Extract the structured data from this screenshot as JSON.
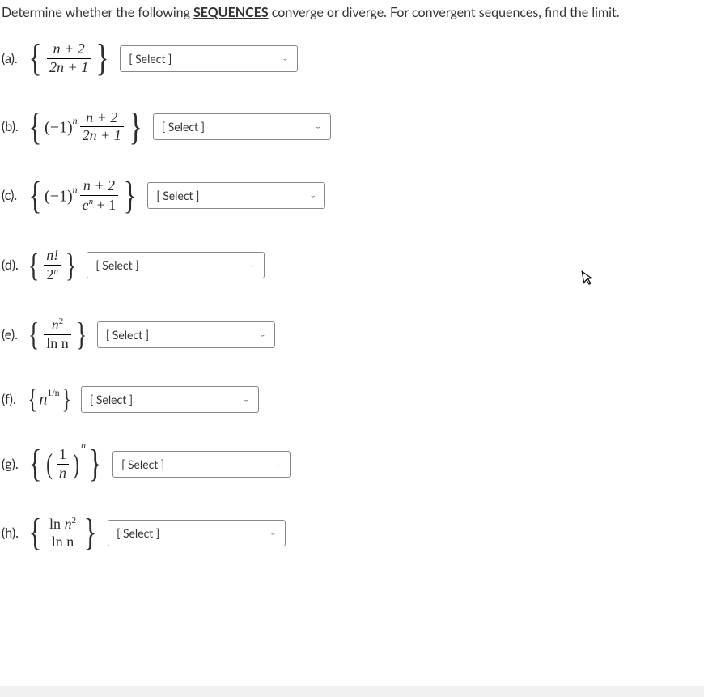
{
  "instructions_pre": "Determine whether the following ",
  "instructions_bold": "SEQUENCES",
  "instructions_post": " converge or diverge.  For convergent sequences, find the limit.",
  "select_placeholder": "[ Select ]",
  "problems": {
    "a": {
      "label": "(a).",
      "num": "n + 2",
      "den": "2n + 1"
    },
    "b": {
      "label": "(b).",
      "coef": "(−1)",
      "exp": "n",
      "num": "n + 2",
      "den": "2n + 1"
    },
    "c": {
      "label": "(c).",
      "coef": "(−1)",
      "exp": "n",
      "num": "n + 2",
      "den_base": "e",
      "den_exp": "n",
      "den_tail": " + 1"
    },
    "d": {
      "label": "(d).",
      "num": "n!",
      "den_base": "2",
      "den_exp": "n"
    },
    "e": {
      "label": "(e).",
      "num_base": "n",
      "num_exp": "2",
      "den": "ln n"
    },
    "f": {
      "label": "(f).",
      "base": "n",
      "exp": "1/n"
    },
    "g": {
      "label": "(g).",
      "inner_num": "1",
      "inner_den": "n",
      "outer_exp": "n"
    },
    "h": {
      "label": "(h).",
      "num_pre": "ln ",
      "num_base": "n",
      "num_exp": "2",
      "den": "ln n"
    }
  }
}
